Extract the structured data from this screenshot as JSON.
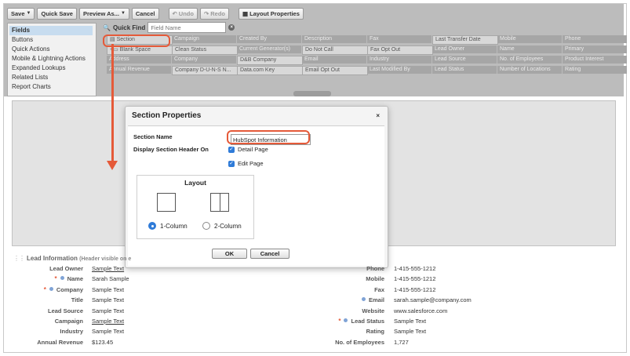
{
  "toolbar": {
    "save": "Save",
    "quick_save": "Quick Save",
    "preview_as": "Preview As...",
    "cancel": "Cancel",
    "undo": "Undo",
    "redo": "Redo",
    "layout_properties": "Layout Properties"
  },
  "sidebar": {
    "items": [
      "Fields",
      "Buttons",
      "Quick Actions",
      "Mobile & Lightning Actions",
      "Expanded Lookups",
      "Related Lists",
      "Report Charts"
    ]
  },
  "quick_find": {
    "label": "Quick Find",
    "placeholder": "Field Name"
  },
  "field_grid": {
    "rows": [
      [
        "Section",
        "Campaign",
        "Created By",
        "Description",
        "Fax",
        "Last Transfer Date",
        "Mobile",
        "Phone"
      ],
      [
        "Blank Space",
        "Clean Status",
        "Current Generator(s)",
        "Do Not Call",
        "Fax Opt Out",
        "Lead Owner",
        "Name",
        "Primary"
      ],
      [
        "Address",
        "Company",
        "D&B Company",
        "Email",
        "Industry",
        "Lead Source",
        "No. of Employees",
        "Product Interest"
      ],
      [
        "Annual Revenue",
        "Company D-U-N-S N...",
        "Data.com Key",
        "Email Opt Out",
        "Last Modified By",
        "Lead Status",
        "Number of Locations",
        "Rating"
      ]
    ]
  },
  "dialog": {
    "title": "Section Properties",
    "close": "×",
    "section_name_label": "Section Name",
    "section_name_value": "HubSpot Information",
    "display_header_label": "Display Section Header On",
    "detail_page": "Detail Page",
    "edit_page": "Edit Page",
    "layout_title": "Layout",
    "one_column": "1-Column",
    "two_column": "2-Column",
    "ok": "OK",
    "cancel": "Cancel"
  },
  "lead_section": {
    "title": "Lead Information",
    "hint": "(Header visible on e",
    "left": [
      {
        "label": "Lead Owner",
        "value": "Sample Text"
      },
      {
        "label": "Name",
        "value": "Sarah Sample"
      },
      {
        "label": "Company",
        "value": "Sample Text"
      },
      {
        "label": "Title",
        "value": "Sample Text"
      },
      {
        "label": "Lead Source",
        "value": "Sample Text"
      },
      {
        "label": "Campaign",
        "value": "Sample Text"
      },
      {
        "label": "Industry",
        "value": "Sample Text"
      },
      {
        "label": "Annual Revenue",
        "value": "$123.45"
      }
    ],
    "right": [
      {
        "label": "Phone",
        "value": "1-415-555-1212"
      },
      {
        "label": "Mobile",
        "value": "1-415-555-1212"
      },
      {
        "label": "Fax",
        "value": "1-415-555-1212"
      },
      {
        "label": "Email",
        "value": "sarah.sample@company.com"
      },
      {
        "label": "Website",
        "value": "www.salesforce.com"
      },
      {
        "label": "Lead Status",
        "value": "Sample Text"
      },
      {
        "label": "Rating",
        "value": "Sample Text"
      },
      {
        "label": "No. of Employees",
        "value": "1,727"
      }
    ]
  },
  "colors": {
    "highlight": "#e55a39",
    "accent": "#2f7bd8",
    "palette_bg": "#bcbcbc"
  }
}
